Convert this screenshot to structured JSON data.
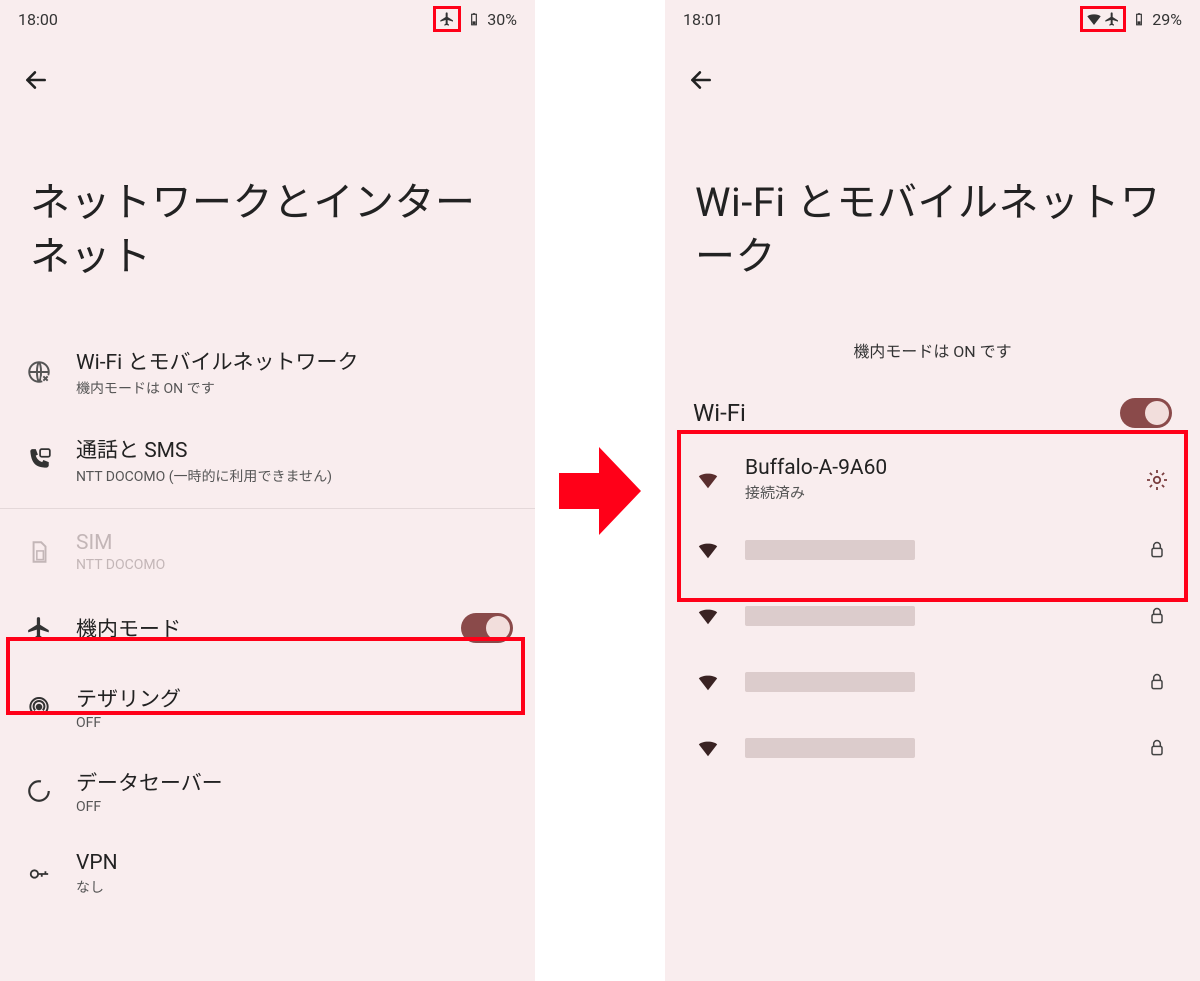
{
  "left": {
    "status": {
      "time": "18:00",
      "battery": "30%"
    },
    "title": "ネットワークとインターネット",
    "items": {
      "wifi": {
        "title": "Wi-Fi とモバイルネットワーク",
        "sub": "機内モードは ON です"
      },
      "calls": {
        "title": "通話と SMS",
        "sub": "NTT DOCOMO (一時的に利用できません)"
      },
      "sim": {
        "title": "SIM",
        "sub": "NTT DOCOMO"
      },
      "airplane": {
        "title": "機内モード"
      },
      "tether": {
        "title": "テザリング",
        "sub": "OFF"
      },
      "saver": {
        "title": "データセーバー",
        "sub": "OFF"
      },
      "vpn": {
        "title": "VPN",
        "sub": "なし"
      }
    }
  },
  "right": {
    "status": {
      "time": "18:01",
      "battery": "29%"
    },
    "title": "Wi-Fi とモバイルネットワーク",
    "note": "機内モードは ON です",
    "wifi_label": "Wi-Fi",
    "connected": {
      "ssid": "Buffalo-A-9A60",
      "status": "接続済み"
    }
  }
}
